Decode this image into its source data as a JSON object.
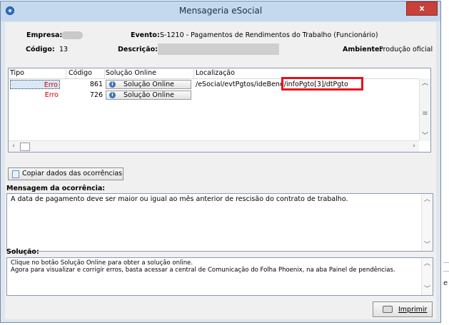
{
  "window": {
    "title": "Mensageria eSocial",
    "close_label": "x"
  },
  "header": {
    "empresa_label": "Empresa:",
    "codigo_label": "Código:",
    "codigo_value": "13",
    "evento_label": "Evento:",
    "evento_value": "S-1210 - Pagamentos de Rendimentos do Trabalho (Funcionário)",
    "descricao_label": "Descrição:",
    "ambiente_label": "Ambiente:",
    "ambiente_value": "Produção oficial"
  },
  "grid": {
    "columns": [
      "Tipo",
      "Código",
      "Solução Online",
      "Localização"
    ],
    "rows": [
      {
        "tipo": "Erro",
        "codigo": "861",
        "solucao": "Solução Online",
        "loc_main": "/eSocial/evtPgtos/ideBene",
        "loc_highlight": "/infoPgto[3]/dtPgto"
      },
      {
        "tipo": "Erro",
        "codigo": "726",
        "solucao": "Solução Online",
        "loc_main": "",
        "loc_highlight": ""
      }
    ]
  },
  "copy_button": "Copiar dados das ocorrências",
  "mensagem": {
    "title": "Mensagem da ocorrência:",
    "text": "A data de pagamento deve ser maior ou igual ao mês anterior de rescisão do contrato de trabalho."
  },
  "solucao": {
    "title": "Solução:",
    "line1": "Clique no botão Solução Online para obter a solução online.",
    "line2": "Agora para visualizar e corrigir erros, basta acessar a central de Comunicação do Folha Phoenix, na aba Painel de pendências."
  },
  "print_button": "Imprimir",
  "background_text": "e",
  "colors": {
    "error": "#cc0000",
    "highlight": "#e8101a",
    "close": "#c7413a",
    "titlebar": "#c4d9ee"
  }
}
